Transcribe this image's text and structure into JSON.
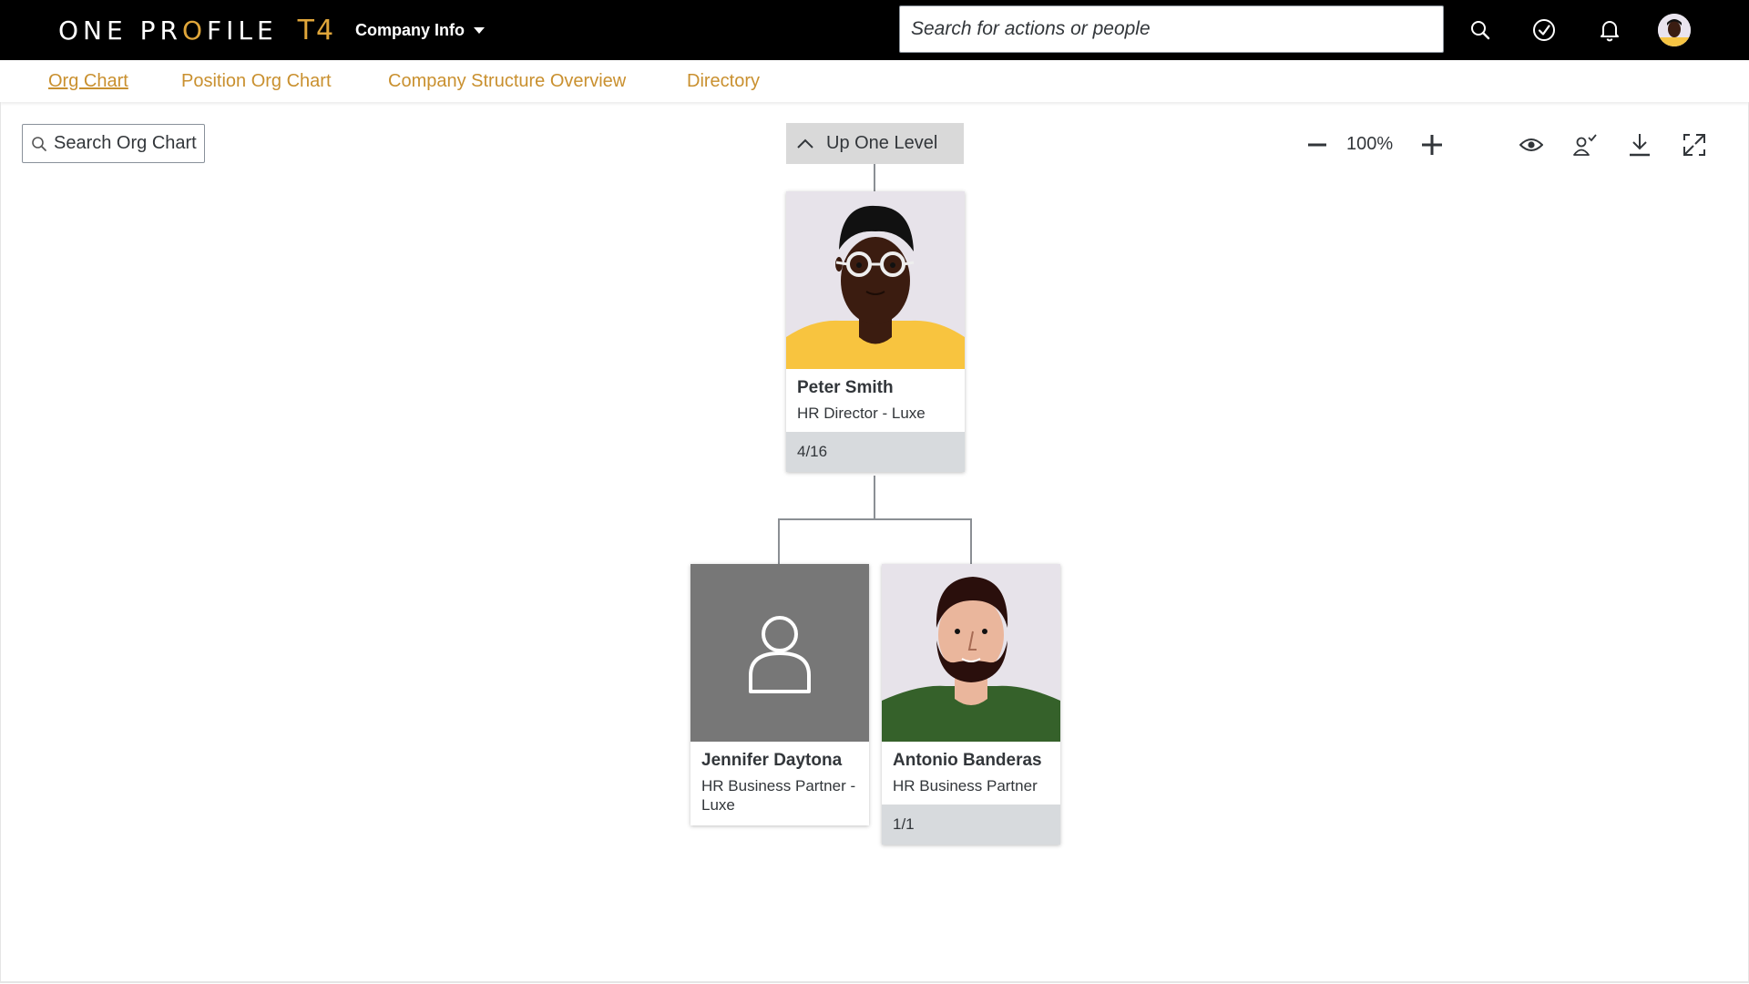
{
  "app": {
    "logo_text": "ONE PROFILE",
    "logo_suffix": "T4",
    "brand_color": "#e0a63a"
  },
  "shellbar": {
    "menu_label": "Company Info",
    "search_placeholder": "Search for actions or people",
    "icons": [
      "search-icon",
      "approve-check-icon",
      "bell-icon",
      "user-avatar"
    ]
  },
  "tabs": [
    {
      "label": "Org Chart",
      "active": true
    },
    {
      "label": "Position Org Chart",
      "active": false
    },
    {
      "label": "Company Structure Overview",
      "active": false
    },
    {
      "label": "Directory",
      "active": false
    }
  ],
  "toolbar": {
    "search_placeholder": "Search Org Chart",
    "up_level_label": "Up One Level",
    "zoom_level": "100%",
    "icons": [
      "zoom-out-icon",
      "zoom-in-icon",
      "eye-icon",
      "person-check-icon",
      "download-icon",
      "fullscreen-icon"
    ]
  },
  "orgchart": {
    "root": {
      "name": "Peter Smith",
      "title": "HR Director - Luxe",
      "count": "4/16",
      "photo": "illustrated-avatar"
    },
    "children": [
      {
        "name": "Jennifer Daytona",
        "title": "HR Business Partner - Luxe",
        "count": "",
        "photo": "placeholder"
      },
      {
        "name": "Antonio Banderas",
        "title": "HR Business Partner",
        "count": "1/1",
        "photo": "illustrated-avatar"
      }
    ]
  }
}
